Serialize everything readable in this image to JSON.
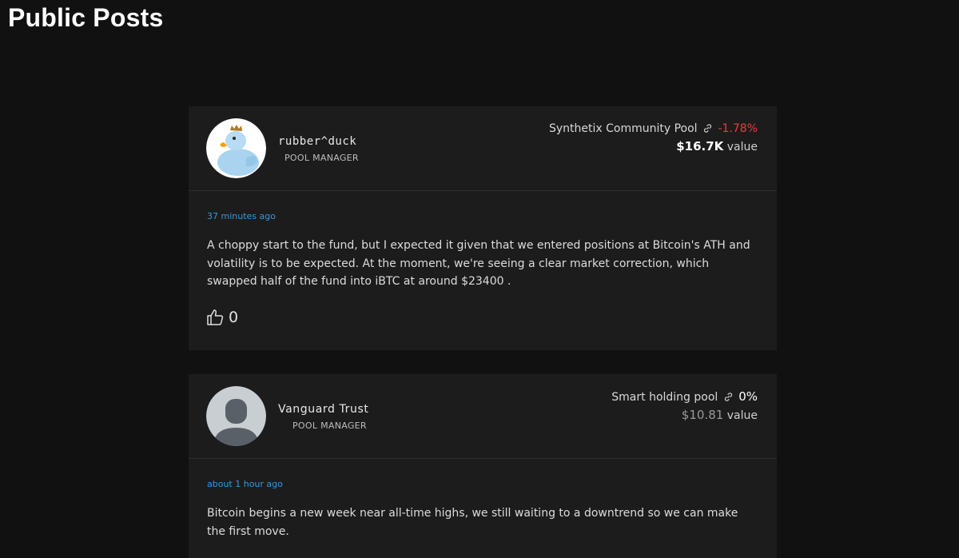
{
  "page": {
    "title": "Public Posts"
  },
  "posts": [
    {
      "author": "rubber^duck",
      "role": "POOL MANAGER",
      "avatar_icon": "rubber-duck-avatar",
      "pool_name": "Synthetix Community Pool",
      "pool_change": "-1.78%",
      "pool_value": "$16.7K",
      "value_label": "value",
      "timestamp": "37 minutes ago",
      "body": "A choppy start to the fund, but I expected it given that we entered positions at Bitcoin's ATH and volatility is to be expected. At the moment, we're seeing a clear market correction, which swapped half of the fund into iBTC at around $23400 .",
      "likes": "0"
    },
    {
      "author": "Vanguard Trust",
      "role": "POOL MANAGER",
      "avatar_icon": "default-user-avatar",
      "pool_name": "Smart holding pool",
      "pool_change": "0%",
      "pool_value": "$10.81",
      "value_label": "value",
      "timestamp": "about 1 hour ago",
      "body": "Bitcoin begins a new week near all-time highs, we still waiting to a downtrend so we can make the first move."
    }
  ],
  "colors": {
    "background": "#111111",
    "card": "#1c1c1c",
    "negative": "#e0413f",
    "timestamp": "#2f9be0"
  }
}
